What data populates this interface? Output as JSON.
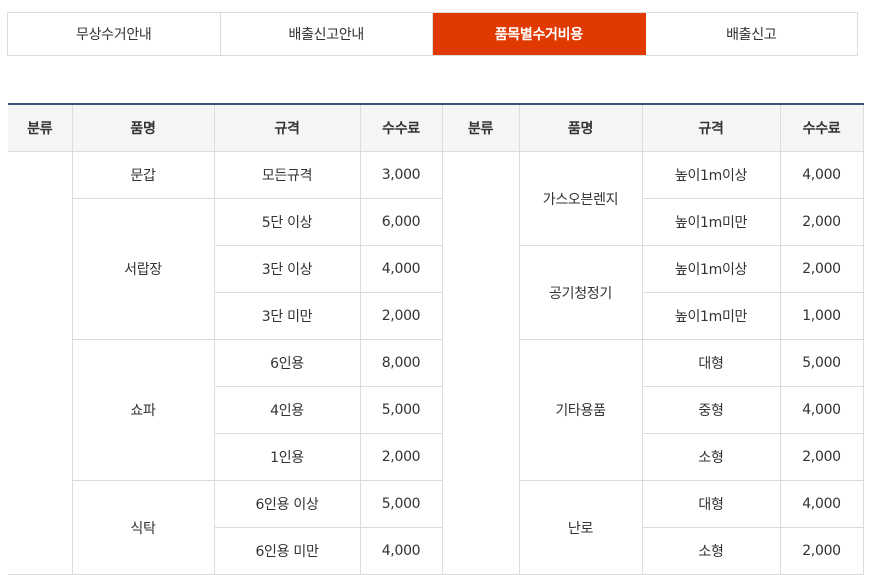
{
  "tabs": [
    {
      "label": "무상수거안내",
      "active": false
    },
    {
      "label": "배출신고안내",
      "active": false
    },
    {
      "label": "품목별수거비용",
      "active": true
    },
    {
      "label": "배출신고",
      "active": false
    }
  ],
  "colors": {
    "accent": "#e03a00",
    "table_top_border": "#3b5475"
  },
  "table": {
    "headers": [
      "분류",
      "품명",
      "규격",
      "수수료",
      "분류",
      "품명",
      "규격",
      "수수료"
    ],
    "left": [
      {
        "name": "문갑",
        "specs": [
          {
            "spec": "모든규격",
            "fee": "3,000"
          }
        ]
      },
      {
        "name": "서랍장",
        "specs": [
          {
            "spec": "5단 이상",
            "fee": "6,000"
          },
          {
            "spec": "3단 이상",
            "fee": "4,000"
          },
          {
            "spec": "3단 미만",
            "fee": "2,000"
          }
        ]
      },
      {
        "name": "쇼파",
        "specs": [
          {
            "spec": "6인용",
            "fee": "8,000"
          },
          {
            "spec": "4인용",
            "fee": "5,000"
          },
          {
            "spec": "1인용",
            "fee": "2,000"
          }
        ]
      },
      {
        "name": "식탁",
        "specs": [
          {
            "spec": "6인용 이상",
            "fee": "5,000"
          },
          {
            "spec": "6인용 미만",
            "fee": "4,000"
          }
        ]
      }
    ],
    "right": [
      {
        "name": "가스오븐렌지",
        "specs": [
          {
            "spec": "높이1m이상",
            "fee": "4,000"
          },
          {
            "spec": "높이1m미만",
            "fee": "2,000"
          }
        ]
      },
      {
        "name": "공기청정기",
        "specs": [
          {
            "spec": "높이1m이상",
            "fee": "2,000"
          },
          {
            "spec": "높이1m미만",
            "fee": "1,000"
          }
        ]
      },
      {
        "name": "기타용품",
        "specs": [
          {
            "spec": "대형",
            "fee": "5,000"
          },
          {
            "spec": "중형",
            "fee": "4,000"
          },
          {
            "spec": "소형",
            "fee": "2,000"
          }
        ]
      },
      {
        "name": "난로",
        "specs": [
          {
            "spec": "대형",
            "fee": "4,000"
          },
          {
            "spec": "소형",
            "fee": "2,000"
          }
        ]
      }
    ]
  }
}
